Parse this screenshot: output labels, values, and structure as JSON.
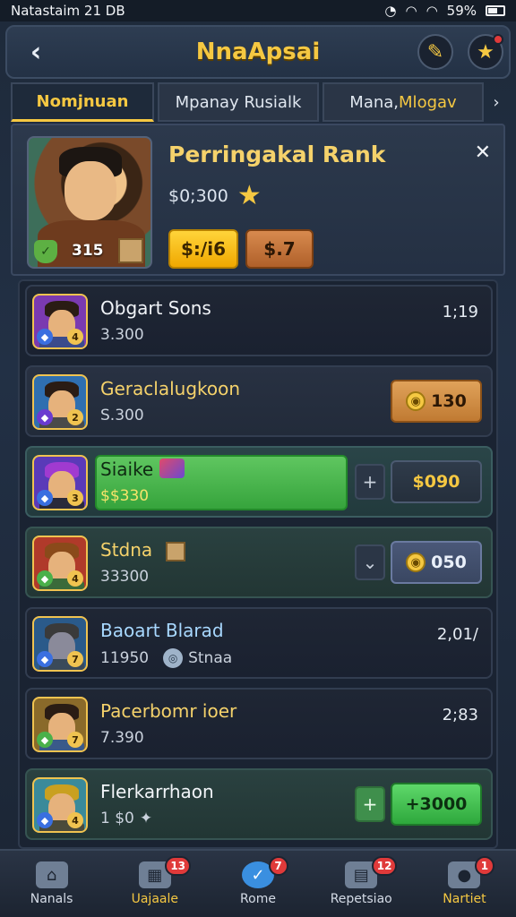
{
  "status_bar": {
    "left_text": "Natastaim 21 DB",
    "battery": "59%"
  },
  "header": {
    "title": "NnaApsai"
  },
  "tabs": [
    {
      "label": "Nomjnuan"
    },
    {
      "label": "Mpanay Rusialk"
    },
    {
      "label_a": "Mana, ",
      "label_b": "Mlogav"
    }
  ],
  "profile": {
    "name": "Perringakal Rank",
    "money": "$0;300",
    "level": "315",
    "pill_yellow": "$:/i6",
    "pill_brown": "$.7"
  },
  "rows": [
    {
      "name": "Obgart Sons",
      "sub": "3.300",
      "value": "1;19",
      "badge": "4"
    },
    {
      "name": "Geraclalugkoon",
      "sub": "S.300",
      "button": "130",
      "badge": "2"
    },
    {
      "name": "Siaike",
      "sub": "$$330",
      "button": "$090",
      "badge": "3"
    },
    {
      "name": "Stdna",
      "sub": "33300",
      "button": "050",
      "badge": "4"
    },
    {
      "name": "Baoart Blarad",
      "sub": "11950",
      "sub_extra": "Stnaa",
      "value": "2,01/",
      "badge": "7"
    },
    {
      "name": "Pacerbomr ioer",
      "sub": "7.390",
      "value": "2;83",
      "badge": "7"
    },
    {
      "name": "Flerkarrhaon",
      "sub": "1 $0",
      "button": "+3000",
      "badge": "4"
    }
  ],
  "nav": [
    {
      "label": "Nanals",
      "badge": ""
    },
    {
      "label": "Uajaale",
      "badge": "13"
    },
    {
      "label": "Rome",
      "badge": "7"
    },
    {
      "label": "Repetsiao",
      "badge": "12"
    },
    {
      "label": "Nartiet",
      "badge": "1"
    }
  ],
  "colors": {
    "accent_gold": "#f5c842",
    "action_green": "#36a43c",
    "badge_red": "#e03a3a"
  }
}
